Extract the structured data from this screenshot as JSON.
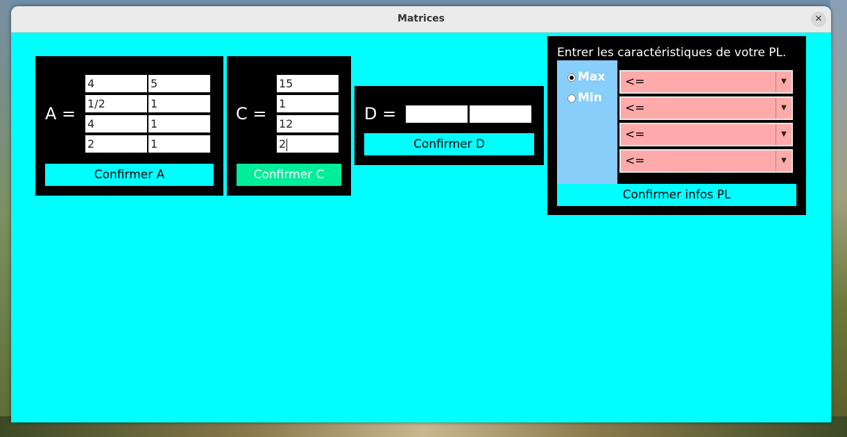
{
  "window": {
    "title": "Matrices",
    "close_glyph": "✕"
  },
  "panel_a": {
    "label": "A =",
    "rows": [
      [
        "4",
        "5"
      ],
      [
        "1/2",
        "1"
      ],
      [
        "4",
        "1"
      ],
      [
        "2",
        "1"
      ]
    ],
    "confirm_label": "Confirmer A"
  },
  "panel_c": {
    "label": "C =",
    "rows": [
      "15",
      "1",
      "12",
      "2"
    ],
    "confirm_label": "Confirmer C"
  },
  "panel_d": {
    "label": "D =",
    "cells": [
      "",
      ""
    ],
    "confirm_label": "Confirmer D"
  },
  "panel_pl": {
    "title": "Entrer les caractéristiques de votre PL.",
    "options": [
      {
        "label": "Max",
        "selected": true
      },
      {
        "label": "Min",
        "selected": false
      }
    ],
    "constraints": [
      "<=",
      "<=",
      "<=",
      "<="
    ],
    "confirm_label": "Confirmer infos PL"
  },
  "colors": {
    "background": "#00ffff",
    "panel": "#000000",
    "active_button": "#00ee99",
    "combo": "#ffaaaa",
    "radio_area": "#87cefa"
  }
}
